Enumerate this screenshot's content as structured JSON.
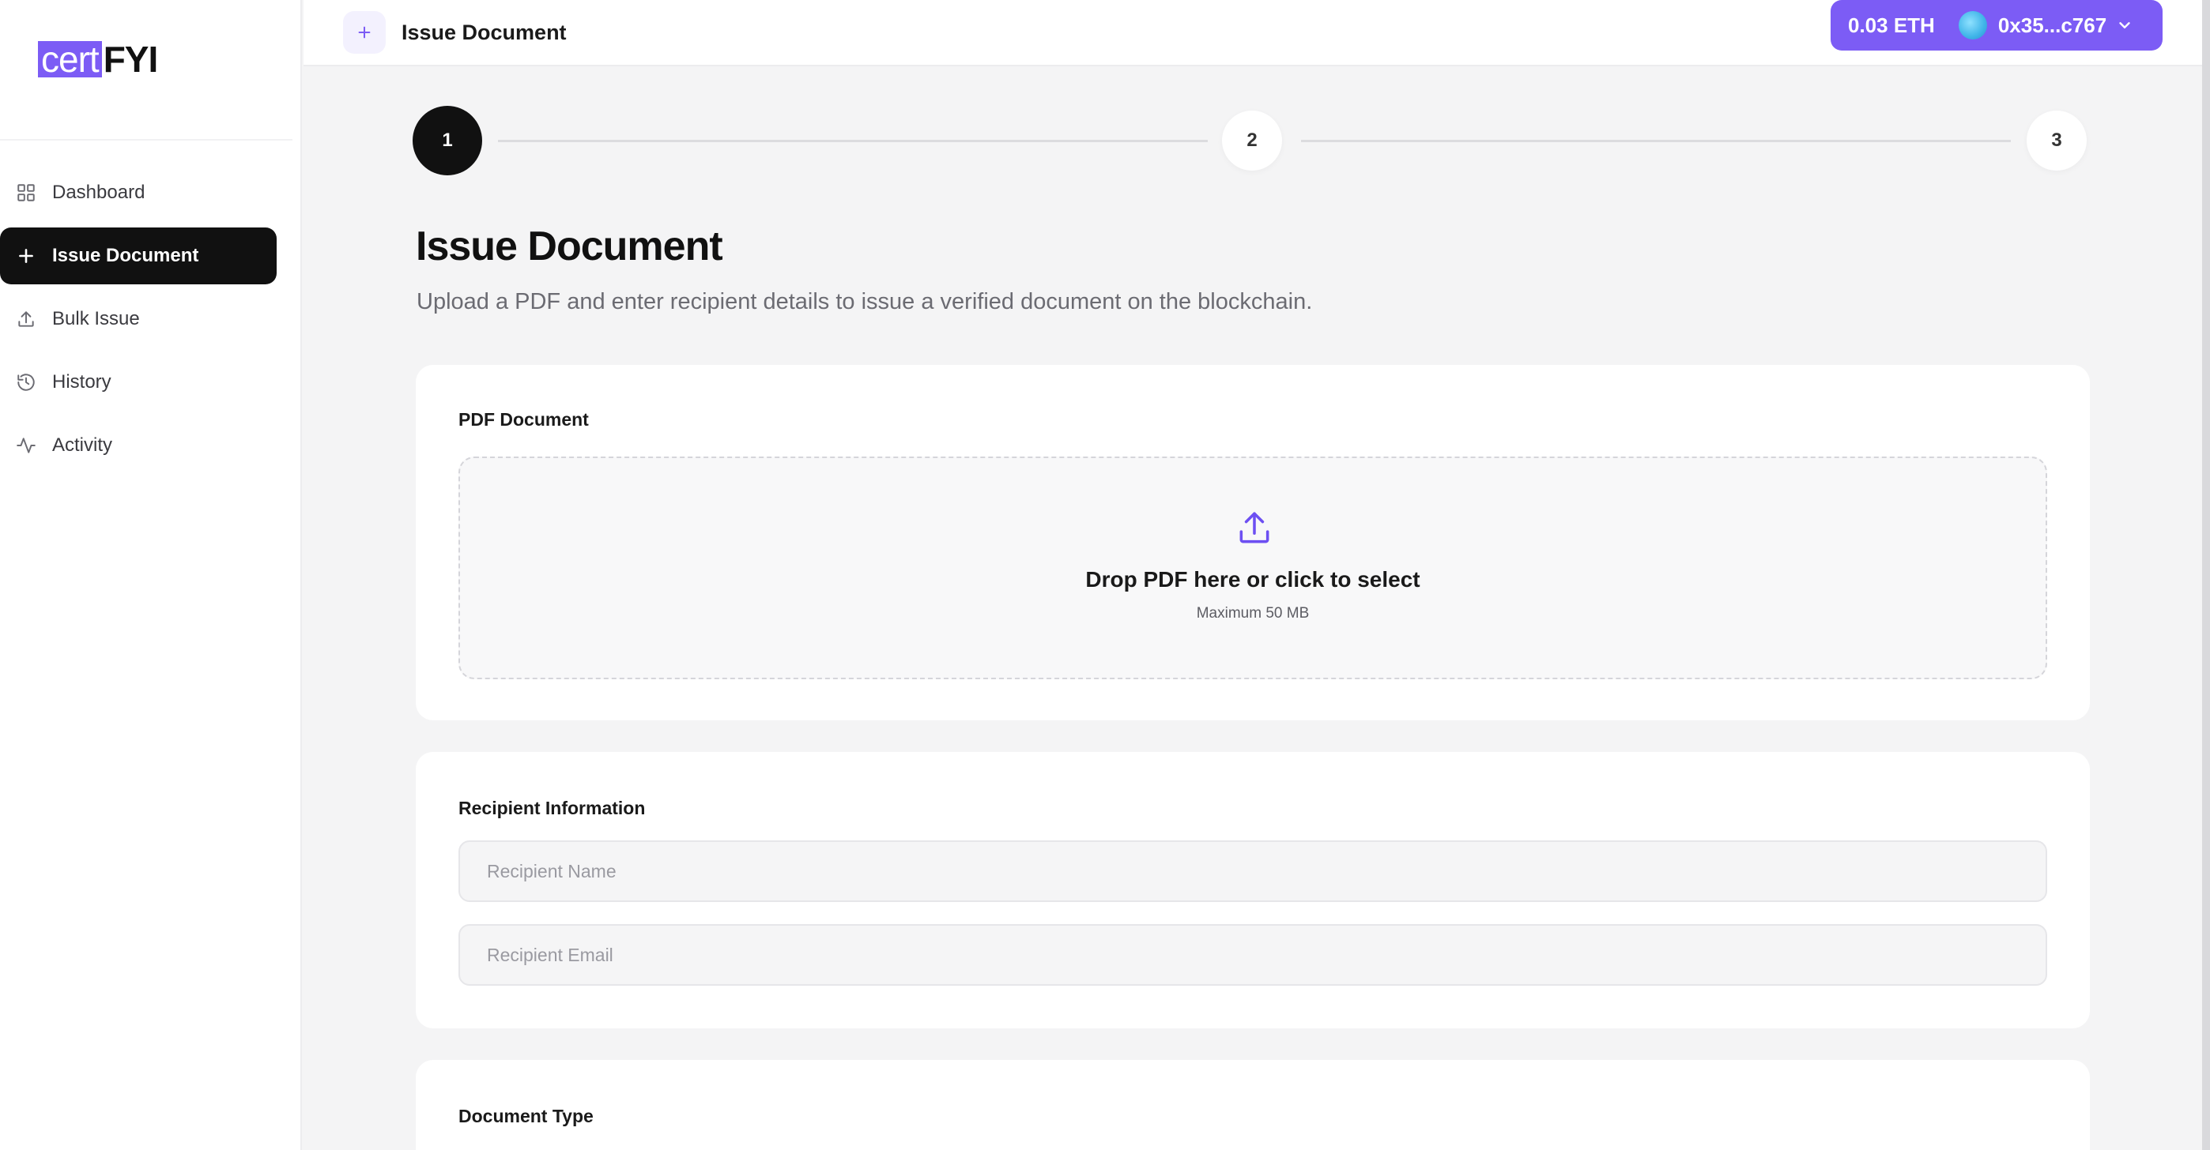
{
  "brand": {
    "logo_part1": "cert",
    "logo_part2": "FYI",
    "accent_color": "#7c5cf5"
  },
  "sidebar": {
    "items": [
      {
        "label": "Dashboard",
        "icon": "dashboard-grid-icon",
        "active": false
      },
      {
        "label": "Issue Document",
        "icon": "plus-icon",
        "active": true
      },
      {
        "label": "Bulk Issue",
        "icon": "upload-icon",
        "active": false
      },
      {
        "label": "History",
        "icon": "history-clock-icon",
        "active": false
      },
      {
        "label": "Activity",
        "icon": "activity-pulse-icon",
        "active": false
      }
    ]
  },
  "header": {
    "title": "Issue Document",
    "wallet": {
      "balance": "0.03 ETH",
      "address": "0x35...c767"
    }
  },
  "stepper": {
    "steps": [
      "1",
      "2",
      "3"
    ],
    "current": 1
  },
  "main": {
    "heading": "Issue Document",
    "subtitle": "Upload a PDF and enter recipient details to issue a verified document on the blockchain.",
    "pdf_section": {
      "label": "PDF Document",
      "drop_title": "Drop PDF here or click to select",
      "drop_hint": "Maximum 50 MB"
    },
    "recipient_section": {
      "label": "Recipient Information",
      "name_placeholder": "Recipient Name",
      "email_placeholder": "Recipient Email"
    },
    "document_type_section": {
      "label": "Document Type"
    }
  }
}
